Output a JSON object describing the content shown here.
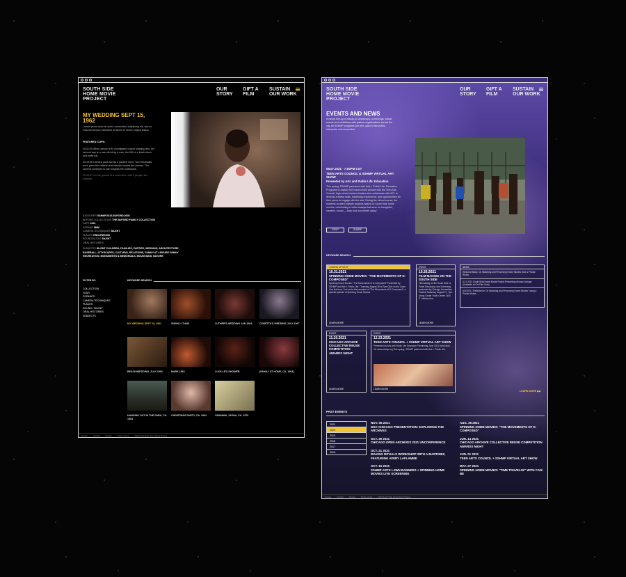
{
  "left": {
    "logo": "SOUTH SIDE HOME MOVIE PROJECT",
    "nav": [
      "OUR STORY",
      "GIFT A FILM",
      "SUSTAIN OUR WORK"
    ],
    "title": "MY WEDDING SEPT 15, 1962",
    "intro": "Lorem ipsum dolor sit amet, consectetur adipiscing elit, sed do eiusmod tempor incididunt ut labore et dolore magna aliqua.",
    "featured_label": "FEATURED CLIPS:",
    "clips": [
      "00:01:09 When advice is fix unmitigated couple shaking pink, the second way is a man directing a man, the fifth in a black dress and white hat.",
      "00:15:56 Camera pans across a packed room. Two individuals each greet the children that wander toward the camera. The camera continues to pan towards the individuals.",
      "00:43:07 On the ground of a cross floor, with 3 people, she watches."
    ],
    "meta": [
      {
        "k": "IDENTIFIER",
        "v": "SSHMP.2016.BUFORD.0000"
      },
      {
        "k": "BEFORE COLLECTIONS",
        "v": "THE BUFORD FAMILY COLLECTION"
      },
      {
        "k": "DATE",
        "v": "1962"
      },
      {
        "k": "FORMAT",
        "v": "8MM"
      },
      {
        "k": "CAMERA TECHNIQUES",
        "v": "SILENT"
      },
      {
        "k": "PLACES",
        "v": "ENGLEWOOD"
      },
      {
        "k": "SOUND/SILENT",
        "v": "SILENT"
      },
      {
        "k": "ORAL HISTORIES",
        "v": ""
      }
    ],
    "subjects_label": "SUBJECTS",
    "subjects": "SILENT CHILDREN, FAMILIES, PARTIES, WEDDING, ARCHITECTURE, BASEBALL, CITYSCAPES, CULTURAL RELATIONS, FAMILY AT LEISURE FAMILY RECREATION, MONUMENTS & MEMORIALS, MOUNTAINS, NATURE",
    "filter_label": "FILTER BY:",
    "filters": [
      "COLLECTION",
      "YEAR",
      "FORMATS",
      "CAMERA TECHNIQUES",
      "PLACES",
      "SOUND / SILENT",
      "ORAL HISTORIES",
      "SUBJECTS"
    ],
    "keyword_label": "KEYWORD SEARCH",
    "thumbs": [
      "MY WEDDING SEPT 15, 1962",
      "5/30/65 + 7/4/65",
      "LUTHER'S WEDDING JAN 1964",
      "CORETTA'S WEDDING JULY 1967",
      "BEACH/WEDDING, JULY 1962",
      "MARK 1962",
      "LUCILLE'S SHOWER",
      "(FAMILY AT HOME, CA. 1964)",
      "HANGING OUT IN THE PARK, CA. 1964",
      "CHRISTMAS PARTY, CA. 1964",
      "OKINAWA, JAPAN, CA. 1976"
    ],
    "footer": [
      "Donate",
      "Contact",
      "Privacy",
      "Terms of Use",
      "2024 South Side Home Movie Project"
    ]
  },
  "right": {
    "logo": "SOUTH SIDE HOME MOVIE PROJECT",
    "nav": [
      "OUR STORY",
      "GIFT A FILM",
      "SUSTAIN OUR WORK"
    ],
    "title": "EVENTS AND NEWS",
    "intro": "A robust line-up of hands-on workshops, screenings, virtual events and exhibitions with partner organizations across the city. All SSHMP programs are free, open to the public, interactive and accessible.",
    "featured_date": "06.07.2021 · 7:00pm CST",
    "featured_title": "TEEN ARTS COUNCIL & SSHMP VIRTUAL ART SHOW",
    "featured_sub": "Presented by Arts and Public Life: Education",
    "featured_body": "This spring, SSHMP partnered with Arts + Public Life: Education Programs to explore the home movie archive with the Teen Arts Council, high school student leaders who collaborate with APL to develop creative skills, leadership experience, and opportunities for their peers to engage with the arts. During the virtual course, the students curated multiple projects based on South Side home movies, culminating in video essays that were on thoughtful, creative, robust — they took our breath away!",
    "btn_rsvp": "RSVP",
    "btn_share": "SHARE",
    "keyword_label": "KEYWORD SEARCH",
    "cards": [
      {
        "tag": "COMING UP NEXT",
        "date": "10.31.2021",
        "title": "SPINNING HOME MOVIES: \"THE MOVEMENTS OF D-COMPOSED\"",
        "body": "Spinning Home Movies: \"The Movements of D-Composed\" Presented by SSHMP and Arts + Public Life. Thursday, August 26 at 7pm Click on the Zoom Live link here. Join us for the premiere of \"The Movements of D-Composed\", a special episode of Spinning Home Movies.",
        "more": "LEARN MORE"
      },
      {
        "tag": "EVENT",
        "date": "10.26.2021",
        "title": "FILM MAKING ON THE SOUTH SIDE",
        "body": "Filmmaking on the South Side: A Panel Discussion and Screening presented by Chicago Humanities Festival Saturday, August 21, 7pm Using Cinder Youth Center 1400 S. Indiana Ave.",
        "more": "LEARN MORE"
      },
      {
        "tag": "EVENT",
        "date": "11.20.2021",
        "title": "CHICAGO ARCHIVE COLLECTIVE REUSE COMPETITION AWARDS NIGHT",
        "body": "",
        "more": "LEARN MORE"
      },
      {
        "tag": "EVENT",
        "date": "12.23.2021",
        "title": "TEEN ARTS COUNCIL + SSHMP VIRTUAL ART SHOW",
        "body": "Presented by Arts and Public Life Education Premiering June 2021 from Noon - On www.sshmp.org This spring, SSHMP partnered with Arts + Public Life.",
        "more": "LEARN MORE"
      }
    ],
    "news_label": "NEWS",
    "news": [
      "Welcome Back: On Watching and Preserving Home Movies from a Private Works",
      "6.21.2021 South Side Home Movie Project Presenting Historic footage (Available at Chi Film Club)",
      "5/3/2021: \"Reflected in On Watching and Preserving Home Movies\" using a Private Works"
    ],
    "learn_more": "LEARN MORE",
    "past_label": "PAST EVENTS",
    "years": [
      "2021",
      "2020",
      "2019",
      "2018",
      "2017",
      "2016"
    ],
    "past_left": [
      {
        "date": "NOV. 06 2021",
        "title": "DGC CHICAGO PRESENTATION: EXPLORING THE ARCHIVES"
      },
      {
        "date": "OCT. 29 2021",
        "title": "CHICAGO OPEN ARCHIVES 2021 UNCONFERENCE"
      },
      {
        "date": "OCT. 21 2021",
        "title": "MAKING RITUALS WORKSHOP WITH A.MARTINEZ, FEATURING AVERY LAFLAMME"
      },
      {
        "date": "OCT. 15 2021",
        "title": "SSHMP ARTS LAWN BANNERS + SPINNING HOME MOVIES LIVE SCREENING"
      }
    ],
    "past_right": [
      {
        "date": "AUG. 26 2021",
        "title": "SPINNING HOME MOVIES: \"THE MOVEMENTS OF D-COMPOSED\""
      },
      {
        "date": "JUN. 14 2021",
        "title": "CHICAGO ARCHIVE COLLECTIVE REUSE COMPETITION AWARDS NIGHT"
      },
      {
        "date": "JUN. 01 2021",
        "title": "TEEN ARTS COUNCIL + SSHMP VIRTUAL ART SHOW"
      },
      {
        "date": "MAY. 27 2021",
        "title": "SPINNING HOME MOVIES: \"TIME TRAVELIN'\" WITH CAM BE"
      }
    ],
    "footer": [
      "Donate",
      "Contact",
      "Privacy",
      "Terms of Use",
      "2024 South Side Home Movie Project"
    ]
  },
  "colors": {
    "accent": "#f1c232",
    "bg": "#050505",
    "purple": "#4a3a95"
  }
}
